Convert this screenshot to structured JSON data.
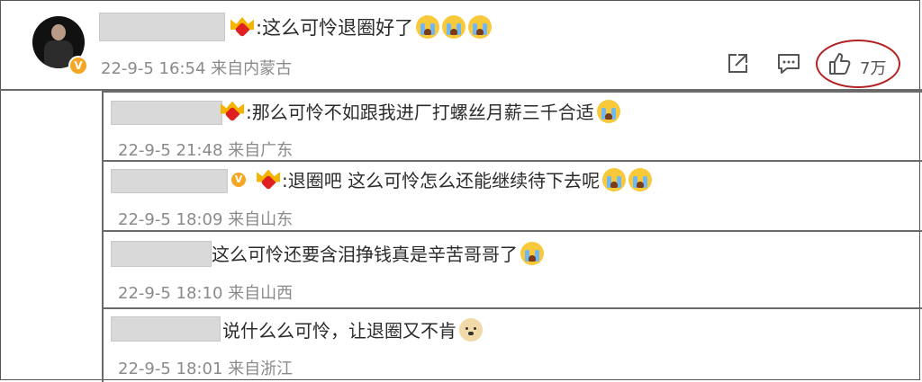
{
  "main": {
    "text": ":这么可怜退圈好了",
    "time": "22-9-5 16:54",
    "location": "来自内蒙古",
    "like_count": "7万",
    "verified": "V"
  },
  "replies": [
    {
      "text": ":那么可怜不如跟我进厂打螺丝月薪三千合适",
      "time": "22-9-5 21:48",
      "location": "来自广东"
    },
    {
      "text": ":退圈吧 这么可怜怎么还能继续待下去呢",
      "time": "22-9-5 18:09",
      "location": "来自山东",
      "verified": "V"
    },
    {
      "text": "这么可怜还要含泪挣钱真是辛苦哥哥了",
      "time": "22-9-5 18:10",
      "location": "来自山西"
    },
    {
      "text": "说什么么可怜，让退圈又不肯",
      "time": "22-9-5 18:01",
      "location": "来自浙江"
    }
  ],
  "icons": [
    "share-icon",
    "comment-icon",
    "like-icon",
    "crown-heart-icon",
    "crying-emoji-icon",
    "doge-emoji-icon"
  ],
  "colors": {
    "highlight_ring": "#b22222",
    "meta_gray": "#8a8a8a",
    "crown_gold": "#f4b400",
    "verified_orange": "#f5a623"
  }
}
